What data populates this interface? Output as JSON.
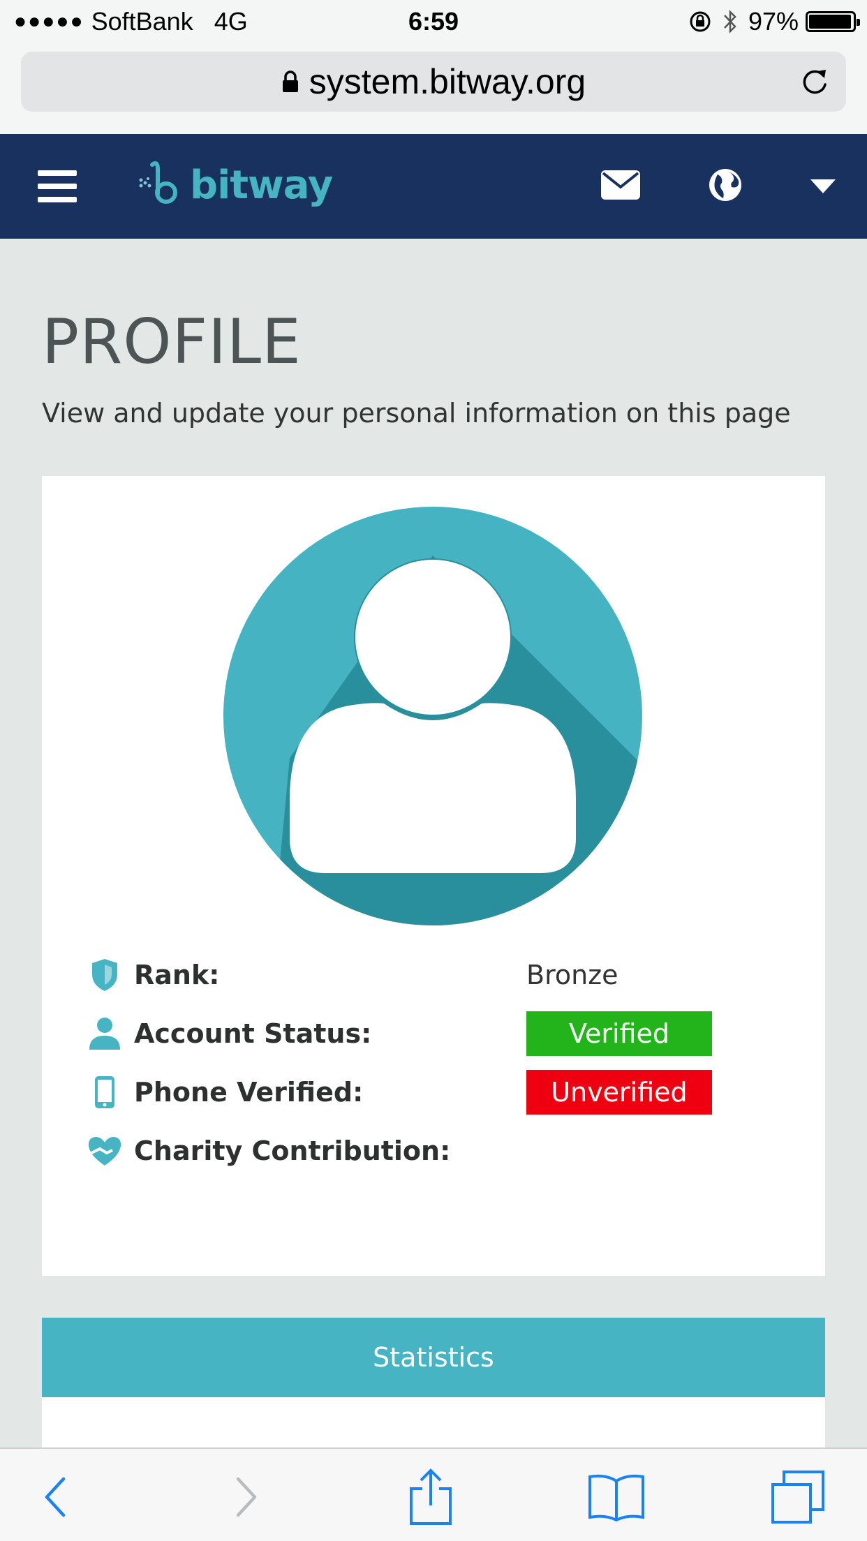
{
  "status_bar": {
    "signal_icon": "signal-dots",
    "carrier": "SoftBank",
    "network": "4G",
    "time": "6:59",
    "battery_percent_text": "97%",
    "battery_level": 0.97
  },
  "browser": {
    "url": "system.bitway.org",
    "lock_icon": "lock-icon",
    "reload_icon": "reload-icon"
  },
  "site_header": {
    "menu_icon": "hamburger-icon",
    "logo_text": "bitway",
    "mail_icon": "envelope-icon",
    "globe_icon": "globe-icon",
    "dropdown_icon": "caret-down-icon",
    "background_color": "#19315e",
    "accent_color": "#46b4c2"
  },
  "page": {
    "title": "PROFILE",
    "subtitle": "View and update your personal information on this page"
  },
  "profile": {
    "avatar_icon": "user-avatar",
    "rows": [
      {
        "icon": "shield-icon",
        "label": "Rank:",
        "value": "Bronze"
      },
      {
        "icon": "user-icon",
        "label": "Account Status:",
        "value": "Verified",
        "status_color": "#22b41a"
      },
      {
        "icon": "phone-icon",
        "label": "Phone Verified:",
        "value": "Unverified",
        "status_color": "#ee0011"
      },
      {
        "icon": "heart-hand-icon",
        "label": "Charity Contribution:",
        "value": ""
      }
    ]
  },
  "statistics": {
    "header": "Statistics"
  },
  "toolbar": {
    "back_icon": "back-icon",
    "forward_icon": "forward-icon",
    "share_icon": "share-icon",
    "bookmarks_icon": "bookmarks-icon",
    "tabs_icon": "tabs-icon"
  }
}
